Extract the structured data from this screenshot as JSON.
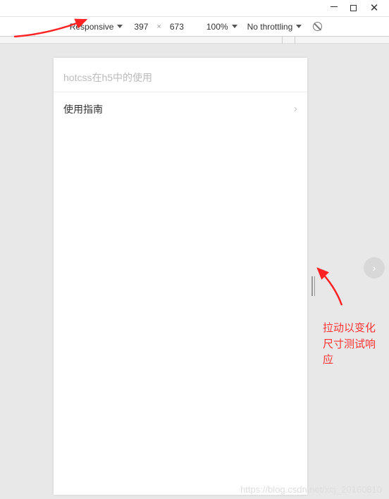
{
  "window": {
    "minimize": "—",
    "maximize": "□",
    "close": "✕"
  },
  "devtools": {
    "device_mode": "Responsive",
    "width": "397",
    "height": "673",
    "zoom": "100%",
    "throttling": "No throttling"
  },
  "page": {
    "title": "hotcss在h5中的使用",
    "guide_label": "使用指南"
  },
  "annotation": {
    "text": "拉动以变化尺寸测试响应"
  },
  "watermark": "https://blog.csdn.net/xcj_20160810"
}
